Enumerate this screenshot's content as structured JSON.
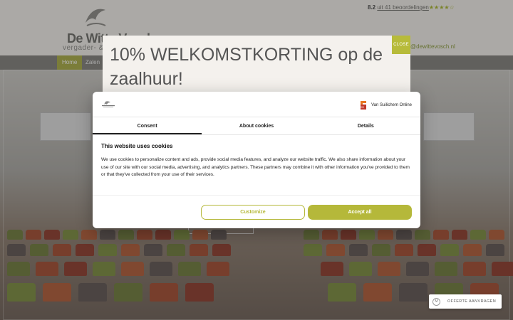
{
  "header": {
    "logo_name": "De Witte Vosch",
    "logo_tagline": "vergader- & r",
    "rating_score": "8.2",
    "rating_link": "uit 41 beoordelingen",
    "rating_stars": "★★★★☆",
    "email_fragment": "@dewittevosch.nl"
  },
  "nav": {
    "items": [
      {
        "label": "Home"
      },
      {
        "label": "Zalen"
      }
    ]
  },
  "promo": {
    "title": "10% WELKOMSTKORTING op de zaalhuur!",
    "close_label": "CLOSE"
  },
  "cookie": {
    "provider_name": "Van Suilichem Online",
    "tabs": [
      {
        "label": "Consent"
      },
      {
        "label": "About cookies"
      },
      {
        "label": "Details"
      }
    ],
    "title": "This website uses cookies",
    "text": "We use cookies to personalize content and ads, provide social media features, and analyze our website traffic. We also share information about your use of our site with our social media, advertising, and analytics partners. These partners may combine it with other information you've provided to them or that they've collected from your use of their services.",
    "customize_label": "Customize",
    "accept_label": "Accept all"
  },
  "widget": {
    "icon_letter": "M",
    "label": "OFFERTE AANVRAGEN"
  },
  "colors": {
    "accent": "#b5b83a",
    "nav_bg": "#807f7a",
    "header_bg": "#f1efea"
  }
}
